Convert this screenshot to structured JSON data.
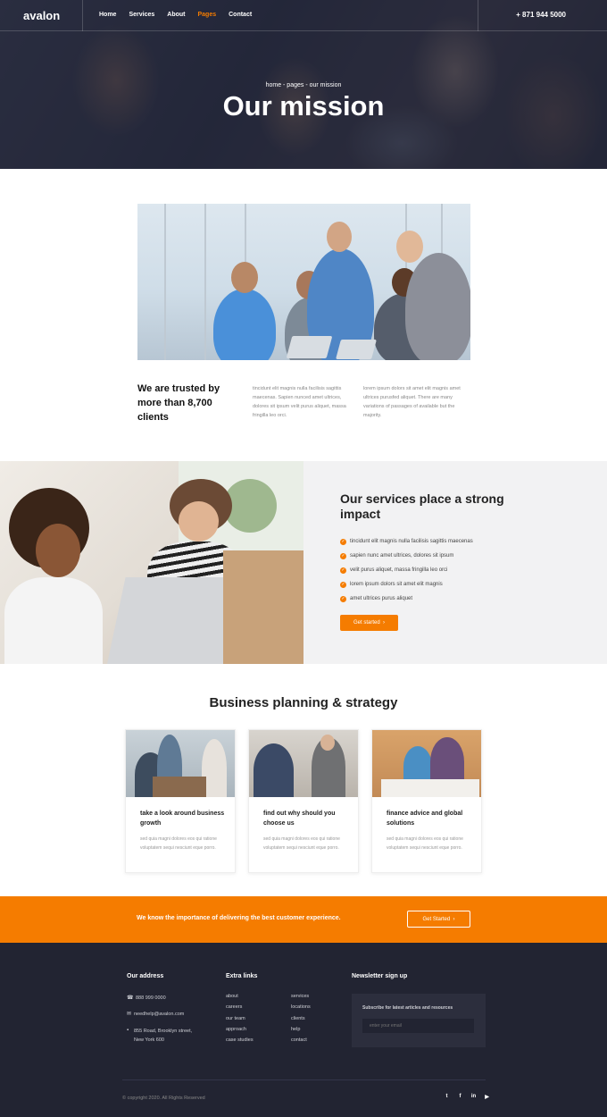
{
  "header": {
    "logo": "avalon",
    "nav": [
      "Home",
      "Services",
      "About",
      "Pages",
      "Contact"
    ],
    "active_nav": "Pages",
    "phone": "+ 871 944 5000"
  },
  "hero": {
    "breadcrumb": "home - pages - our mission",
    "title": "Our mission"
  },
  "mission": {
    "trust_text": "We are trusted by more than 8,700 clients",
    "para1": "tincidunt elit magnis nulla facilisis sagittis maecenas. Sapien nunced amet ultrices, dolores sit ipsum velit purus aliquet, massa fringilla leo orci.",
    "para2": "lorem ipsum dolors sit amet elit magnis amet ultrices purusfed aliquet. There are many variations of passages of available but the majority."
  },
  "services": {
    "title": "Our services place a strong impact",
    "items": [
      "tincidunt elit magnis nulla facilisis sagittis maecenas",
      "sapien nunc amet ultrices, dolores sit ipsum",
      "velit purus aliquet, massa fringilla leo orci",
      "lorem ipsum dolors sit amet elit magnis",
      "amet ultrices purus aliquet"
    ],
    "button": "Get started",
    "button_arrow": "›"
  },
  "planning": {
    "title": "Business planning & strategy",
    "cards": [
      {
        "title": "take a look around business growth",
        "text": "sed quia magni dolores eos qui ratione voluptatem sequi nesciunt eque porro."
      },
      {
        "title": "find out why should you choose us",
        "text": "sed quia magni dolores eos qui ratione voluptatem sequi nesciunt eque porro."
      },
      {
        "title": "finance advice and global solutions",
        "text": "sed quia magni dolores eos qui ratione voluptatem sequi nesciunt eque porro."
      }
    ]
  },
  "cta": {
    "text": "We know the importance of delivering the best customer experience.",
    "button": "Get Started",
    "button_arrow": "›"
  },
  "footer": {
    "address_title": "Our address",
    "phone": "888 999 0000",
    "email": "needhelp@avalon.com",
    "address_line1": "855 Road, Brooklyn street,",
    "address_line2": "New York 600",
    "links_title": "Extra links",
    "links_col1": [
      "about",
      "careers",
      "our team",
      "approach",
      "case studies"
    ],
    "links_col2": [
      "services",
      "locations",
      "clients",
      "help",
      "contact"
    ],
    "newsletter_title": "Newsletter sign up",
    "newsletter_label": "Subscribe for latest articles and resources",
    "newsletter_placeholder": "enter your email",
    "copyright": "© copyright 2020. All Rights Reserved",
    "socials": [
      "twitter-icon",
      "facebook-icon",
      "linkedin-icon",
      "youtube-icon"
    ]
  },
  "colors": {
    "accent": "#f57c00",
    "dark": "#222432"
  }
}
